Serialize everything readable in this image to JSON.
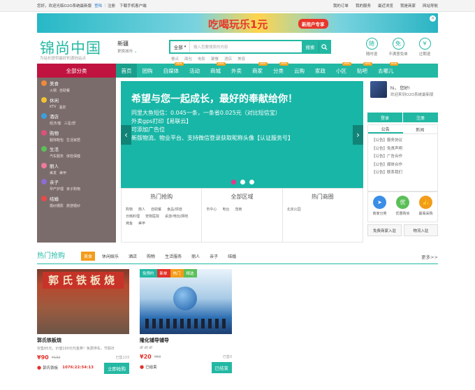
{
  "topbar": {
    "welcome": "您好，欢迎光临O2O系统最新版",
    "login": "登陆",
    "sep": "|",
    "register": "注册",
    "download": "下载手机客户端",
    "links": [
      "我的订单",
      "我的服务",
      "最近浏览",
      "我是商家",
      "网站导航"
    ]
  },
  "banner": {
    "text": "吃喝玩乐1元",
    "tag": "新用户专享",
    "close": "×"
  },
  "header": {
    "logo": "锦尚中国",
    "slogan": "为站长提供最好的源码站点",
    "city": "新疆",
    "switch_city": "更换城市",
    "search": {
      "select": "全部",
      "placeholder": "输入您要搜索的内容",
      "button": "搜索"
    },
    "keywords": [
      "餐点",
      "面包",
      "电影",
      "聚餐",
      "酒店",
      "美容"
    ],
    "perks": [
      {
        "icon": "随",
        "label": "随时退"
      },
      {
        "icon": "免",
        "label": "不满意免单"
      },
      {
        "icon": "¥",
        "label": "过期退"
      }
    ]
  },
  "nav": {
    "category": "全部分类",
    "items": [
      {
        "label": "首页",
        "is_new": false,
        "active": true
      },
      {
        "label": "团购",
        "is_new": false,
        "active": false
      },
      {
        "label": "自媒体",
        "is_new": true,
        "active": false
      },
      {
        "label": "活动",
        "is_new": false,
        "active": false
      },
      {
        "label": "商城",
        "is_new": true,
        "active": false
      },
      {
        "label": "外卖",
        "is_new": false,
        "active": false
      },
      {
        "label": "商家",
        "is_new": true,
        "active": false
      },
      {
        "label": "分类",
        "is_new": true,
        "active": false
      },
      {
        "label": "云购",
        "is_new": false,
        "active": false
      },
      {
        "label": "家政",
        "is_new": false,
        "active": false
      },
      {
        "label": "小区",
        "is_new": true,
        "active": false
      },
      {
        "label": "贴吧",
        "is_new": true,
        "active": false
      },
      {
        "label": "去哪儿",
        "is_new": true,
        "active": false
      }
    ],
    "new_badge": "NEW"
  },
  "sidebar": [
    {
      "title": "美食",
      "subs": [
        "火锅",
        "自助餐"
      ],
      "color": "#f08a3b"
    },
    {
      "title": "休闲",
      "subs": [
        "KTV",
        "温泉"
      ],
      "color": "#f1c232"
    },
    {
      "title": "酒店",
      "subs": [
        "经济/客",
        "三星/舒"
      ],
      "color": "#3aa0e0"
    },
    {
      "title": "购物",
      "subs": [
        "服饰鞋包",
        "生活家居"
      ],
      "color": "#e0507b"
    },
    {
      "title": "生活",
      "subs": [
        "汽车服务",
        "体检保健"
      ],
      "color": "#5bbf58"
    },
    {
      "title": "丽人",
      "subs": [
        "美发",
        "美甲"
      ],
      "color": "#f07a9c"
    },
    {
      "title": "亲子",
      "subs": [
        "孕产护理",
        "亲子购物"
      ],
      "color": "#8e6cd4"
    },
    {
      "title": "结婚",
      "subs": [
        "婚纱摄影",
        "旅游婚纱"
      ],
      "color": "#e84a4a"
    }
  ],
  "slider": {
    "headline": "希望与您一起成长，最好的奉献给你！",
    "lines": [
      "同里大鱼短信：0.045一条，一条省0.025元（对比短信宝）",
      "外卖gps打印【易联云】",
      "可添加广告位",
      "新版物流、物业平台、支持微信登录获取昵称头像【认证服务号】"
    ],
    "prev": "‹",
    "next": "›"
  },
  "panels": [
    {
      "title": "热门抢购",
      "links": [
        "购物",
        "丽人",
        "自助餐",
        "食品/烘焙",
        "日韩料理",
        "宠物医院",
        "桌游/电玩/网吧",
        "烤鱼",
        "美甲"
      ]
    },
    {
      "title": "全部区域",
      "links": [
        "市中心",
        "电台",
        "茂南"
      ]
    },
    {
      "title": "热门商圈",
      "links": [
        "北京公园"
      ]
    }
  ],
  "user": {
    "hi": "hi，",
    "name": "您好!",
    "welcome": "欢迎来到O2O系统最新版",
    "login": "登录",
    "register": "注册"
  },
  "news": {
    "tabs": [
      "公告",
      "新闻"
    ],
    "items": [
      "【公告】服务协议",
      "【公告】免责声明",
      "【公告】广告合作",
      "【公告】媒体合作",
      "【公告】联系我们"
    ]
  },
  "services": [
    {
      "icon": "➤",
      "label": "商家分类",
      "color": "#3a8ee6"
    },
    {
      "icon": "优",
      "label": "优惠购买",
      "color": "#5bbf58"
    },
    {
      "icon": "👍",
      "label": "最易采购",
      "color": "#f39c1a"
    }
  ],
  "join": {
    "free": "免费商家入驻",
    "logistics": "物流入驻"
  },
  "hot": {
    "title": "热门抢购",
    "tabs": [
      "美食",
      "休闲娱乐",
      "酒店",
      "购物",
      "生活服务",
      "丽人",
      "亲子",
      "结婚"
    ],
    "more": "更多>>"
  },
  "cards": [
    {
      "sign": "郭氏铁板烧",
      "title": "郭氏铁板烧",
      "desc": "仅售65元，价值100元代金券！免费停车，节假日",
      "price": "¥90",
      "oprice": "¥132",
      "sold": "已售133",
      "shop": "郭氏铁板",
      "time": "1076:22:54:13",
      "button": "立即抢购",
      "badges": []
    },
    {
      "title": "隆化铺导铺导",
      "desc": "df df df",
      "price": "¥20",
      "oprice": "¥50",
      "sold": "已售0",
      "shop": "已结束",
      "time": "",
      "button": "已结束",
      "badges": [
        {
          "label": "免预约",
          "color": "#23b8a3"
        },
        {
          "label": "新单",
          "color": "#e0322a"
        },
        {
          "label": "热门",
          "color": "#f39c1a"
        },
        {
          "label": "精选",
          "color": "#5bbf58"
        }
      ]
    }
  ],
  "colors": {
    "primary": "#23b8a3",
    "red": "#c0133f",
    "side": "#7a6c6b"
  }
}
